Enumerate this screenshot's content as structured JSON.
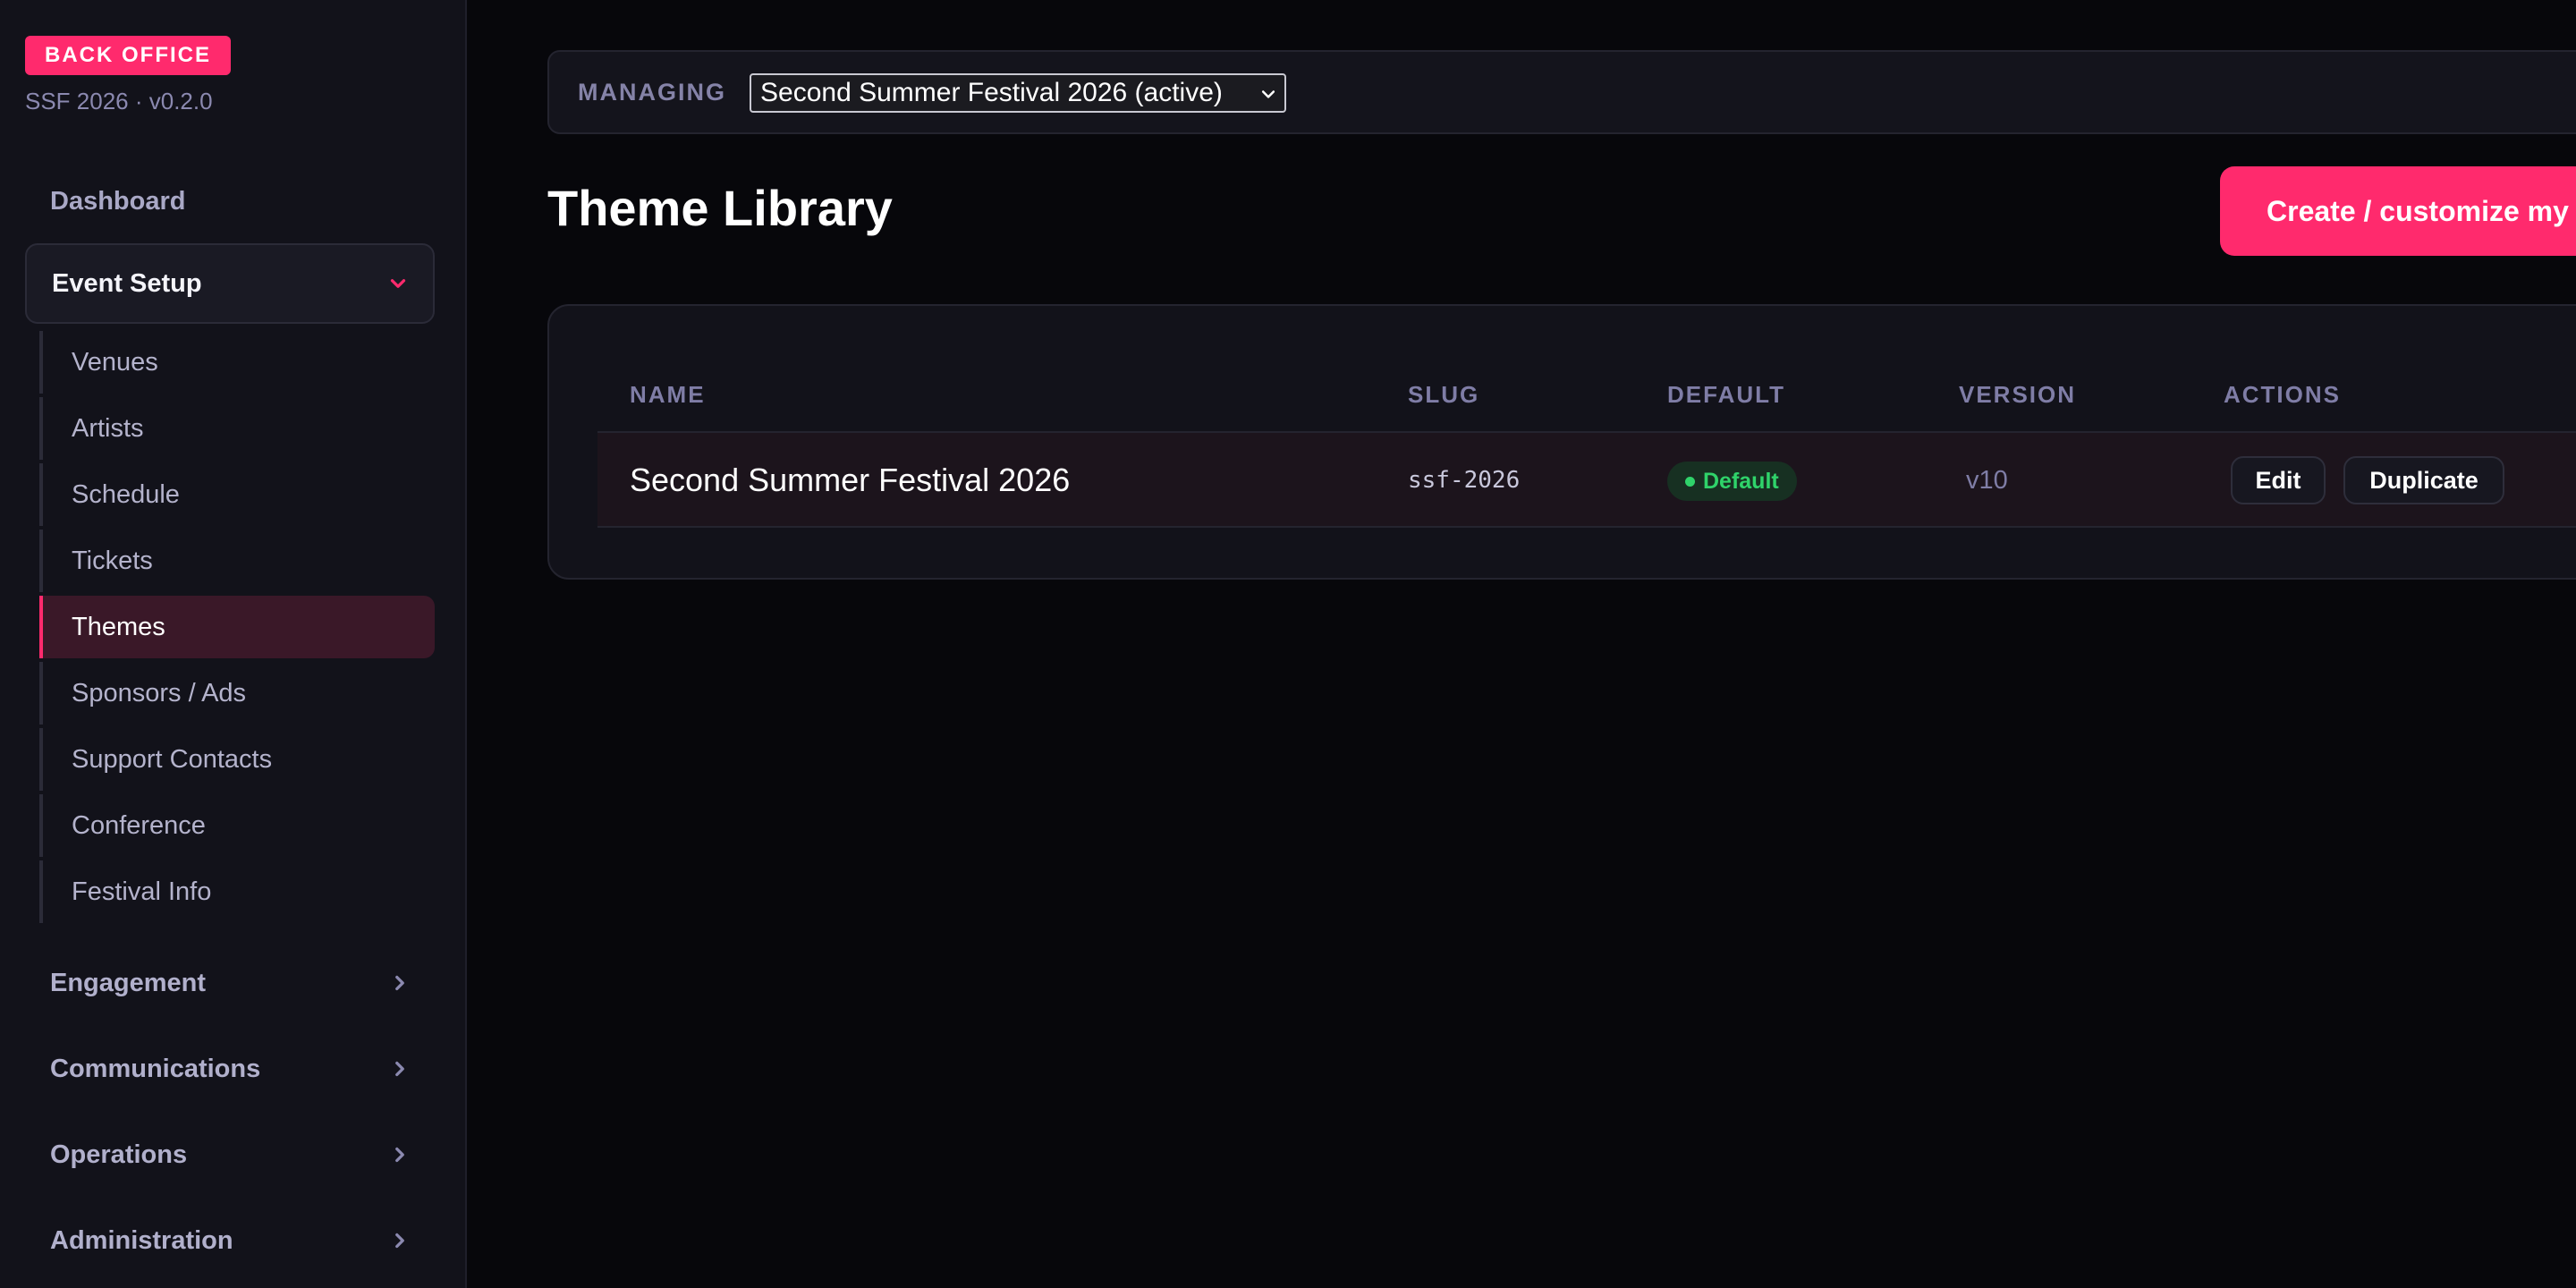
{
  "brand": {
    "badge": "BACK OFFICE",
    "subtitle": "SSF 2026 · v0.2.0"
  },
  "sidebar": {
    "dashboard": "Dashboard",
    "open_group": {
      "label": "Event Setup",
      "items": [
        {
          "label": "Venues",
          "active": false
        },
        {
          "label": "Artists",
          "active": false
        },
        {
          "label": "Schedule",
          "active": false
        },
        {
          "label": "Tickets",
          "active": false
        },
        {
          "label": "Themes",
          "active": true
        },
        {
          "label": "Sponsors / Ads",
          "active": false
        },
        {
          "label": "Support Contacts",
          "active": false
        },
        {
          "label": "Conference",
          "active": false
        },
        {
          "label": "Festival Info",
          "active": false
        }
      ]
    },
    "collapsed_groups": [
      "Engagement",
      "Communications",
      "Operations",
      "Administration"
    ]
  },
  "managing": {
    "label": "MANAGING",
    "selected": "Second Summer Festival 2026 (active)"
  },
  "page": {
    "title": "Theme Library",
    "create_button": "Create / customize my theme"
  },
  "table": {
    "headers": [
      "NAME",
      "SLUG",
      "DEFAULT",
      "VERSION",
      "ACTIONS"
    ],
    "rows": [
      {
        "name": "Second Summer Festival 2026",
        "slug": "ssf-2026",
        "default_badge": "Default",
        "version": "v10",
        "actions": [
          "Edit",
          "Duplicate"
        ]
      }
    ]
  },
  "colors": {
    "accent": "#ff2a6d",
    "background": "#07070b",
    "sidebar": "#12121a",
    "success": "#2fd36a"
  },
  "icons": {
    "chevron_open": "chevron-down-icon",
    "chevron_collapsed": "chevron-right-icon",
    "select_arrow": "chevron-down-icon",
    "badge_dot": "status-dot-icon"
  }
}
